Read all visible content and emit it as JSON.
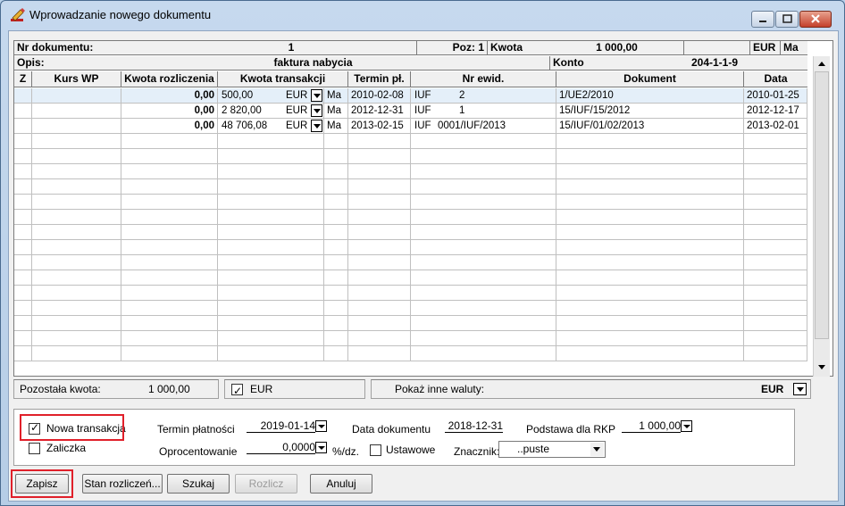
{
  "window": {
    "title": "Wprowadzanie nowego dokumentu"
  },
  "header": {
    "nr_label": "Nr dokumentu:",
    "nr_value": "1",
    "poz_label": "Poz: 1",
    "kwota_label": "Kwota",
    "kwota_value": "1 000,00",
    "currency": "EUR",
    "side": "Ma",
    "opis_label": "Opis:",
    "opis_value": "faktura nabycia",
    "konto_label": "Konto",
    "konto_value": "204-1-1-9"
  },
  "columns": [
    "Z",
    "Kurs WP",
    "Kwota rozliczenia",
    "Kwota transakcji",
    "Termin pł.",
    "Nr ewid.",
    "Dokument",
    "Data"
  ],
  "rows": [
    {
      "kwota_rozl": "0,00",
      "kwota_trans": "500,00",
      "waluta": "EUR",
      "strona": "Ma",
      "termin": "2010-02-08",
      "ewid_prefix": "IUF",
      "ewid_no": "2",
      "dokument": "1/UE2/2010",
      "data": "2010-01-25"
    },
    {
      "kwota_rozl": "0,00",
      "kwota_trans": "2 820,00",
      "waluta": "EUR",
      "strona": "Ma",
      "termin": "2012-12-31",
      "ewid_prefix": "IUF",
      "ewid_no": "1",
      "dokument": "15/IUF/15/2012",
      "data": "2012-12-17"
    },
    {
      "kwota_rozl": "0,00",
      "kwota_trans": "48 706,08",
      "waluta": "EUR",
      "strona": "Ma",
      "termin": "2013-02-15",
      "ewid_prefix": "IUF",
      "ewid_no": "0001/IUF/2013",
      "dokument": "15/IUF/01/02/2013",
      "data": "2013-02-01"
    }
  ],
  "status": {
    "remaining_label": "Pozostała kwota:",
    "remaining_value": "1 000,00",
    "eur_check_label": "EUR",
    "other_currencies_label": "Pokaż inne waluty:",
    "other_currency_value": "EUR"
  },
  "form": {
    "nowa_transakcja": "Nowa transakcja",
    "zaliczka": "Zaliczka",
    "termin_label": "Termin płatności",
    "termin_value": "2019-01-14",
    "data_dok_label": "Data dokumentu",
    "data_dok_value": "2018-12-31",
    "podstawa_label": "Podstawa dla RKP",
    "podstawa_value": "1 000,00",
    "oprocentowanie_label": "Oprocentowanie",
    "oprocentowanie_value": "0,0000",
    "percent_unit": "%/dz.",
    "ustawowe_label": "Ustawowe",
    "znacznik_label": "Znacznik:",
    "znacznik_value": "..puste"
  },
  "buttons": {
    "zapisz": "Zapisz",
    "stan": "Stan rozliczeń...",
    "szukaj": "Szukaj",
    "rozlicz": "Rozlicz",
    "anuluj": "Anuluj"
  }
}
